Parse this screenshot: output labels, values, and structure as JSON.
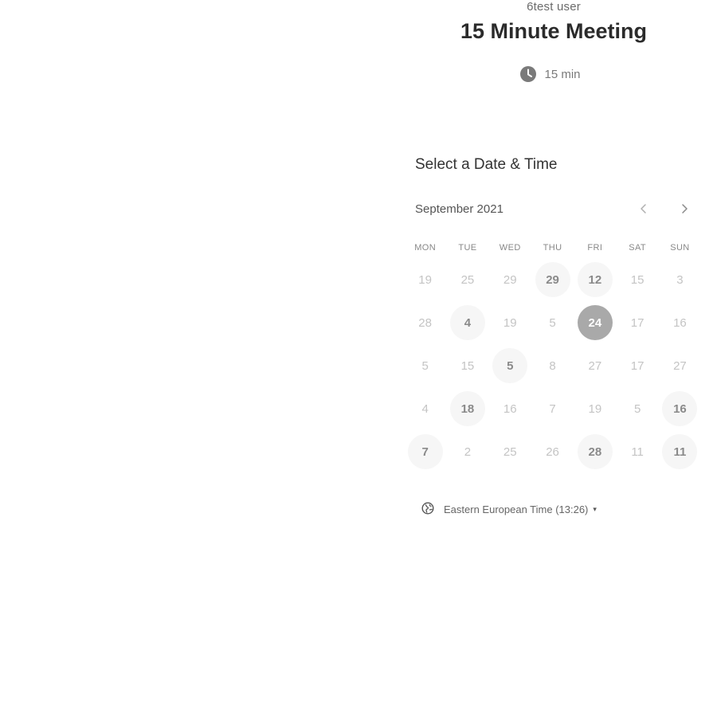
{
  "header": {
    "user_name": "6test user",
    "event_title": "15 Minute Meeting",
    "duration": "15 min"
  },
  "picker": {
    "section_title": "Select a Date & Time",
    "month_label": "September 2021",
    "weekdays": [
      "MON",
      "TUE",
      "WED",
      "THU",
      "FRI",
      "SAT",
      "SUN"
    ],
    "days": [
      {
        "label": "19",
        "state": "disabled"
      },
      {
        "label": "25",
        "state": "disabled"
      },
      {
        "label": "29",
        "state": "disabled"
      },
      {
        "label": "29",
        "state": "available"
      },
      {
        "label": "12",
        "state": "available"
      },
      {
        "label": "15",
        "state": "disabled"
      },
      {
        "label": "3",
        "state": "disabled"
      },
      {
        "label": "28",
        "state": "disabled"
      },
      {
        "label": "4",
        "state": "available"
      },
      {
        "label": "19",
        "state": "disabled"
      },
      {
        "label": "5",
        "state": "disabled"
      },
      {
        "label": "24",
        "state": "selected"
      },
      {
        "label": "17",
        "state": "disabled"
      },
      {
        "label": "16",
        "state": "disabled"
      },
      {
        "label": "5",
        "state": "disabled"
      },
      {
        "label": "15",
        "state": "disabled"
      },
      {
        "label": "5",
        "state": "available"
      },
      {
        "label": "8",
        "state": "disabled"
      },
      {
        "label": "27",
        "state": "disabled"
      },
      {
        "label": "17",
        "state": "disabled"
      },
      {
        "label": "27",
        "state": "disabled"
      },
      {
        "label": "4",
        "state": "disabled"
      },
      {
        "label": "18",
        "state": "available"
      },
      {
        "label": "16",
        "state": "disabled"
      },
      {
        "label": "7",
        "state": "disabled"
      },
      {
        "label": "19",
        "state": "disabled"
      },
      {
        "label": "5",
        "state": "disabled"
      },
      {
        "label": "16",
        "state": "available"
      },
      {
        "label": "7",
        "state": "available"
      },
      {
        "label": "2",
        "state": "disabled"
      },
      {
        "label": "25",
        "state": "disabled"
      },
      {
        "label": "26",
        "state": "disabled"
      },
      {
        "label": "28",
        "state": "available"
      },
      {
        "label": "11",
        "state": "disabled"
      },
      {
        "label": "11",
        "state": "available"
      }
    ]
  },
  "timezone": {
    "label": "Eastern European Time (13:26)",
    "caret": "▾"
  },
  "icons": {
    "duration": "clock-icon",
    "prev_month": "chevron-left-icon",
    "next_month": "chevron-right-icon",
    "timezone": "globe-icon"
  },
  "colors": {
    "selected_day": "#a9a9a9",
    "available_day_bg": "#f6f6f6",
    "disabled_day_text": "#c4c4c4"
  }
}
